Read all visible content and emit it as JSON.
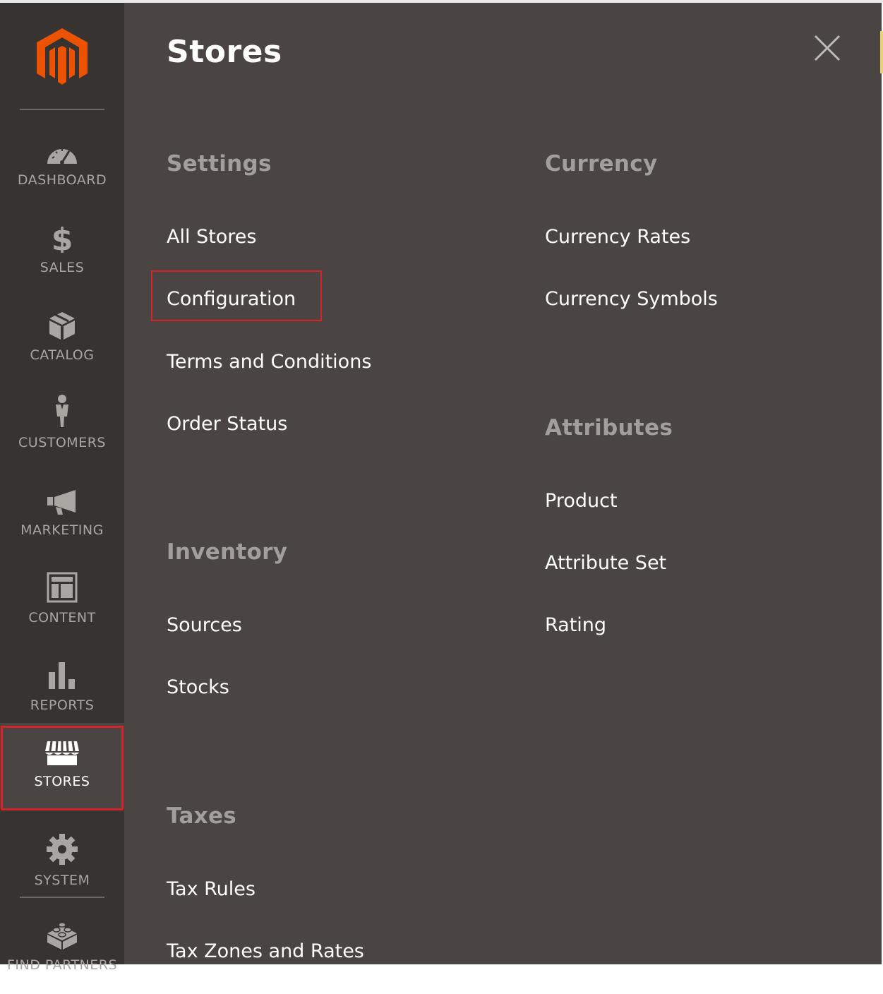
{
  "nav": {
    "items": [
      {
        "id": "dashboard",
        "label": "DASHBOARD",
        "icon": "dashboard-icon"
      },
      {
        "id": "sales",
        "label": "SALES",
        "icon": "dollar-icon"
      },
      {
        "id": "catalog",
        "label": "CATALOG",
        "icon": "box-icon"
      },
      {
        "id": "customers",
        "label": "CUSTOMERS",
        "icon": "person-icon"
      },
      {
        "id": "marketing",
        "label": "MARKETING",
        "icon": "megaphone-icon"
      },
      {
        "id": "content",
        "label": "CONTENT",
        "icon": "layout-icon"
      },
      {
        "id": "reports",
        "label": "REPORTS",
        "icon": "bar-chart-icon"
      },
      {
        "id": "stores",
        "label": "STORES",
        "icon": "storefront-icon",
        "active": true
      },
      {
        "id": "system",
        "label": "SYSTEM",
        "icon": "gear-icon"
      },
      {
        "id": "find-partners",
        "label": "FIND PARTNERS",
        "icon": "lego-brick-icon"
      }
    ]
  },
  "panel": {
    "title": "Stores",
    "sections": {
      "settings": {
        "title": "Settings",
        "links": [
          "All Stores",
          "Configuration",
          "Terms and Conditions",
          "Order Status"
        ]
      },
      "inventory": {
        "title": "Inventory",
        "links": [
          "Sources",
          "Stocks"
        ]
      },
      "taxes": {
        "title": "Taxes",
        "links": [
          "Tax Rules",
          "Tax Zones and Rates"
        ]
      },
      "currency": {
        "title": "Currency",
        "links": [
          "Currency Rates",
          "Currency Symbols"
        ]
      },
      "attributes": {
        "title": "Attributes",
        "links": [
          "Product",
          "Attribute Set",
          "Rating"
        ]
      }
    }
  },
  "colors": {
    "nav_bg": "#373330",
    "panel_bg": "#4a4542",
    "brand_orange": "#eb5202",
    "highlight_red": "#d7222a",
    "section_title": "#a19e9b"
  }
}
